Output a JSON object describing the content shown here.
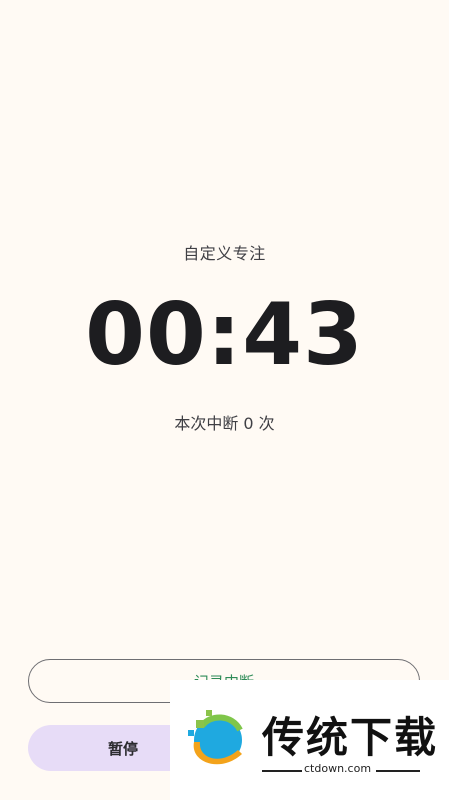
{
  "focus": {
    "mode_label": "自定义专注",
    "timer": "00:43",
    "interrupt_count": "本次中断 0 次"
  },
  "actions": {
    "record_label": "记录中断",
    "pause_label": "暂停"
  },
  "watermark": {
    "title": "传统下载",
    "domain": "ctdown.com"
  },
  "colors": {
    "background": "#fffaf4",
    "pause_bg": "#e7dcf7",
    "record_text": "#2e8b57"
  }
}
